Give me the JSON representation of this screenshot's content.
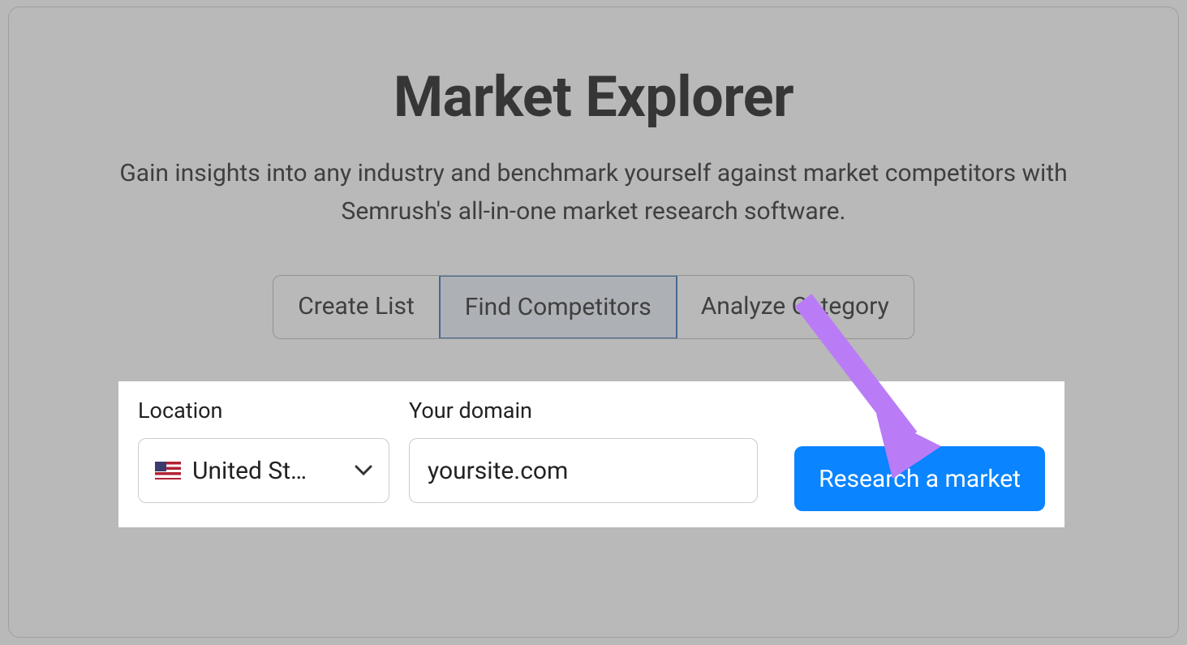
{
  "header": {
    "title": "Market Explorer",
    "subtitle": "Gain insights into any industry and benchmark yourself against market competitors with Semrush's all-in-one market research software."
  },
  "tabs": {
    "items": [
      {
        "label": "Create List"
      },
      {
        "label": "Find Competitors"
      },
      {
        "label": "Analyze Category"
      }
    ],
    "active_index": 1
  },
  "form": {
    "location_label": "Location",
    "location_value": "United St…",
    "location_icon": "flag-us",
    "domain_label": "Your domain",
    "domain_value": "yoursite.com",
    "submit_label": "Research a market"
  },
  "colors": {
    "accent": "#0a84ff",
    "annotation": "#b97cf6"
  }
}
